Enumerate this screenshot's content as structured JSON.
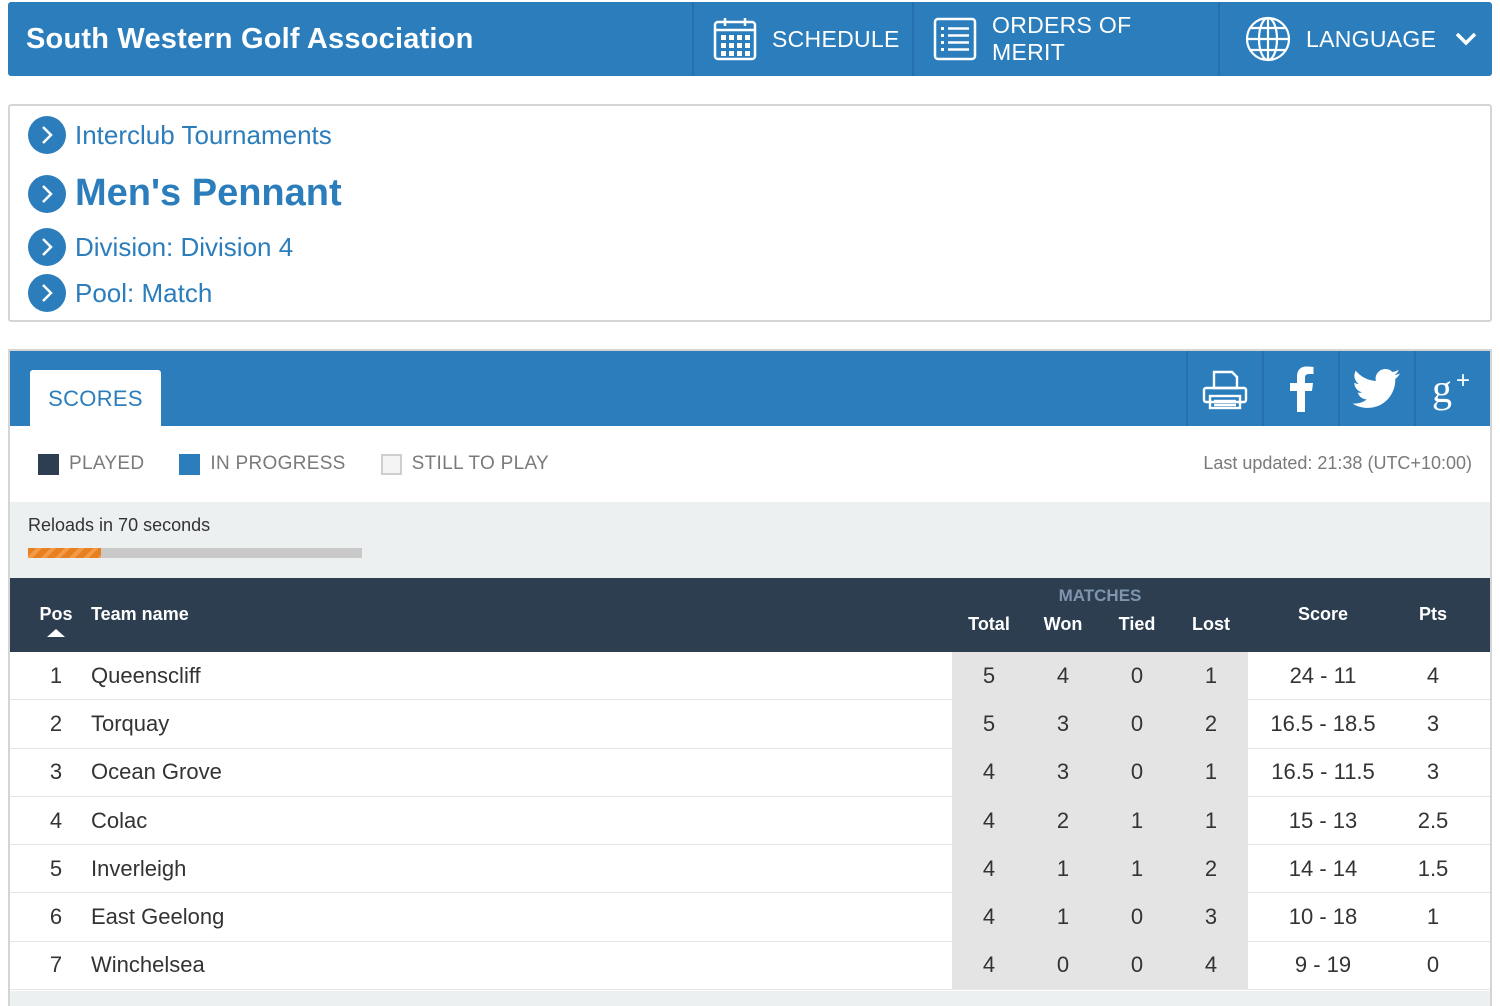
{
  "header": {
    "brand": "South Western Golf Association",
    "nav": {
      "schedule": "SCHEDULE",
      "orders_of_merit": "ORDERS OF MERIT",
      "language": "LANGUAGE"
    }
  },
  "breadcrumb": {
    "items": [
      {
        "label": "Interclub Tournaments"
      },
      {
        "label": "Men's Pennant"
      },
      {
        "label": "Division: Division 4"
      },
      {
        "label": "Pool: Match"
      }
    ]
  },
  "scores_panel": {
    "tab_label": "SCORES",
    "share_icons": [
      "printer-icon",
      "facebook-icon",
      "twitter-icon",
      "google-plus-icon"
    ],
    "legend": {
      "played": "PLAYED",
      "in_progress": "IN PROGRESS",
      "still_to_play": "STILL TO PLAY"
    },
    "last_updated": "Last updated: 21:38 (UTC+10:00)",
    "reload_text": "Reloads in 70 seconds",
    "reload_progress_fraction": 0.22
  },
  "table": {
    "headers": {
      "pos": "Pos",
      "team": "Team name",
      "matches_group": "MATCHES",
      "total": "Total",
      "won": "Won",
      "tied": "Tied",
      "lost": "Lost",
      "score": "Score",
      "pts": "Pts"
    },
    "rows": [
      {
        "pos": "1",
        "team": "Queenscliff",
        "total": "5",
        "won": "4",
        "tied": "0",
        "lost": "1",
        "score": "24 - 11",
        "pts": "4"
      },
      {
        "pos": "2",
        "team": "Torquay",
        "total": "5",
        "won": "3",
        "tied": "0",
        "lost": "2",
        "score": "16.5 - 18.5",
        "pts": "3"
      },
      {
        "pos": "3",
        "team": "Ocean Grove",
        "total": "4",
        "won": "3",
        "tied": "0",
        "lost": "1",
        "score": "16.5 - 11.5",
        "pts": "3"
      },
      {
        "pos": "4",
        "team": "Colac",
        "total": "4",
        "won": "2",
        "tied": "1",
        "lost": "1",
        "score": "15 - 13",
        "pts": "2.5"
      },
      {
        "pos": "5",
        "team": "Inverleigh",
        "total": "4",
        "won": "1",
        "tied": "1",
        "lost": "2",
        "score": "14 - 14",
        "pts": "1.5"
      },
      {
        "pos": "6",
        "team": "East Geelong",
        "total": "4",
        "won": "1",
        "tied": "0",
        "lost": "3",
        "score": "10 - 18",
        "pts": "1"
      },
      {
        "pos": "7",
        "team": "Winchelsea",
        "total": "4",
        "won": "0",
        "tied": "0",
        "lost": "4",
        "score": "9 - 19",
        "pts": "0"
      }
    ]
  },
  "colors": {
    "primary_blue": "#2b7dbc",
    "dark_header": "#2c3e50",
    "reload_orange": "#e9801f"
  }
}
